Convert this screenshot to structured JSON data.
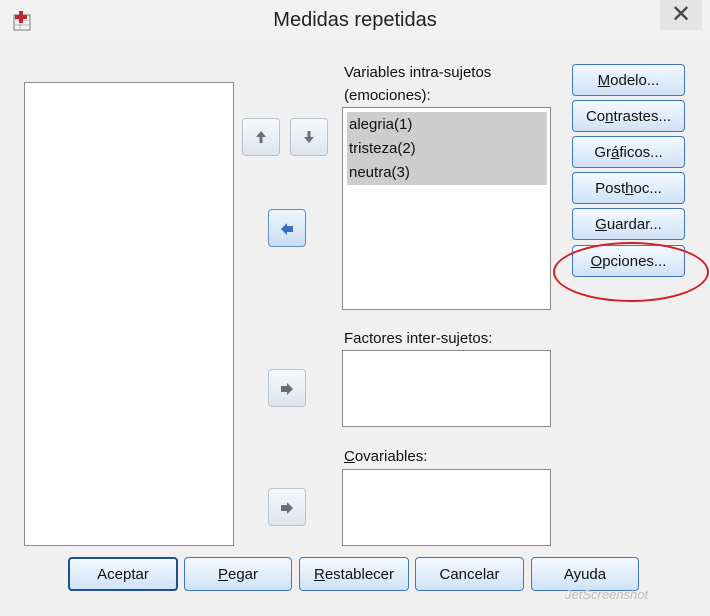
{
  "window": {
    "title": "Medidas repetidas",
    "close_glyph": "✕"
  },
  "within_subjects": {
    "label_line1": "Variables intra-sujetos",
    "label_line2": "(emociones):",
    "items": [
      "alegria(1)",
      "tristeza(2)",
      "neutra(3)"
    ]
  },
  "between_subjects": {
    "label": "Factores inter-sujetos:"
  },
  "covariates": {
    "label_u": "C",
    "label_rest": "ovariables:"
  },
  "side_buttons": {
    "model": {
      "u": "M",
      "rest": "odelo..."
    },
    "contrasts": {
      "pre": "Co",
      "u": "n",
      "rest": "trastes..."
    },
    "graphs": {
      "pre": "Gr",
      "u": "á",
      "rest": "ficos..."
    },
    "posthoc": {
      "pre": "Post ",
      "u": "h",
      "rest": "oc..."
    },
    "save": {
      "u": "G",
      "rest": "uardar..."
    },
    "options": {
      "u": "O",
      "rest": "pciones..."
    }
  },
  "bottom_buttons": {
    "ok": "Aceptar",
    "paste": {
      "u": "P",
      "rest": "egar"
    },
    "reset": {
      "u": "R",
      "rest": "establecer"
    },
    "cancel": "Cancelar",
    "help": "Ayuda"
  },
  "watermark": "JetScreenshot",
  "annotation_color": "#d42020"
}
